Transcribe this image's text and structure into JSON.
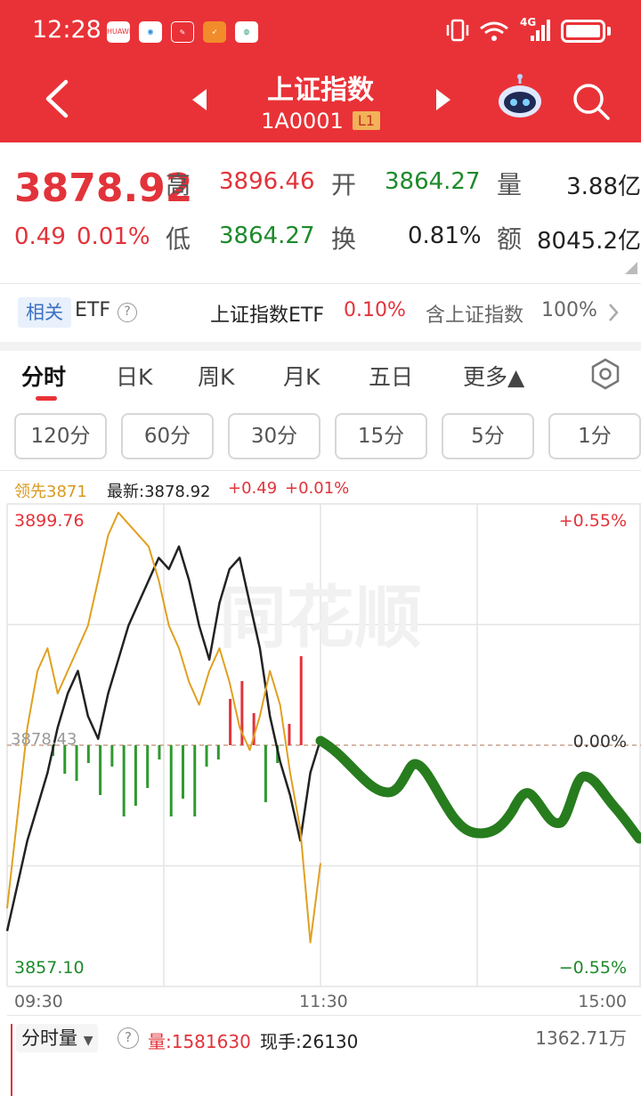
{
  "status_bar": {
    "time": "12:28",
    "app_icons": [
      "HUAWEI",
      "browser",
      "news",
      "news2",
      "app"
    ],
    "network": "4G",
    "indicators": [
      "vibrate-icon",
      "wifi-icon",
      "signal-icon",
      "battery-icon"
    ]
  },
  "header": {
    "title": "上证指数",
    "code": "1A0001",
    "level": "L1"
  },
  "quote": {
    "price": "3878.92",
    "change": "0.49",
    "change_pct": "0.01%",
    "high_label": "高",
    "high": "3896.46",
    "low_label": "低",
    "low": "3864.27",
    "open_label": "开",
    "open": "3864.27",
    "turnover_label": "换",
    "turnover": "0.81%",
    "volume_label": "量",
    "volume": "3.88亿",
    "amount_label": "额",
    "amount": "8045.2亿"
  },
  "etf": {
    "badge": "相关",
    "label": "ETF",
    "help": "?",
    "name": "上证指数ETF",
    "pct": "0.10%",
    "contains": "含上证指数",
    "contains_pct": "100%"
  },
  "tabs": [
    "分时",
    "日K",
    "周K",
    "月K",
    "五日",
    "更多▲"
  ],
  "period_buttons": [
    "120分",
    "60分",
    "30分",
    "15分",
    "5分",
    "1分"
  ],
  "chart_legend": {
    "lead": "领先3871",
    "latest": "最新:3878.92",
    "change": "+0.49",
    "change_pct": "+0.01%"
  },
  "chart_axes": {
    "top_price": "3899.76",
    "top_pct": "+0.55%",
    "mid_price": "3878.43",
    "mid_pct": "0.00%",
    "bottom_price": "3857.10",
    "bottom_pct": "−0.55%",
    "time_start": "09:30",
    "time_mid": "11:30",
    "time_end": "15:00"
  },
  "watermark": "同花顺",
  "volume_panel": {
    "selector": "分时量",
    "help": "?",
    "volume": "量:1581630",
    "current": "现手:26130",
    "max": "1362.71万"
  },
  "chart_data": {
    "type": "line",
    "ylim": [
      3857.1,
      3899.76
    ],
    "x_ticks": [
      "09:30",
      "11:30",
      "15:00"
    ],
    "series": [
      {
        "name": "最新",
        "color": "#222222",
        "values": [
          3862,
          3866,
          3870,
          3873,
          3876,
          3880,
          3883,
          3885,
          3881,
          3879,
          3883,
          3886,
          3889,
          3891,
          3893,
          3895,
          3894,
          3896,
          3893,
          3889,
          3886,
          3891,
          3894,
          3895,
          3891,
          3887,
          3881,
          3877,
          3874,
          3870,
          3876,
          3878.92
        ]
      },
      {
        "name": "领先",
        "color": "#e0a020",
        "values": [
          3864,
          3872,
          3880,
          3885,
          3887,
          3883,
          3885,
          3887,
          3889,
          3893,
          3897,
          3899,
          3898,
          3897,
          3896,
          3893,
          3889,
          3887,
          3884,
          3882,
          3885,
          3887,
          3884,
          3880,
          3878,
          3881,
          3885,
          3882,
          3876,
          3871,
          3861,
          3868
        ]
      }
    ],
    "volume_bars_pct": [
      -0.3,
      -0.8,
      -1.0,
      -0.5,
      -1.4,
      -0.6,
      -2.0,
      -1.7,
      -1.2,
      -0.4,
      -2.0,
      -1.5,
      -2.0,
      -0.6,
      -0.4,
      1.3,
      1.8,
      0.9,
      -1.6,
      -0.5,
      0.6,
      2.5
    ]
  }
}
